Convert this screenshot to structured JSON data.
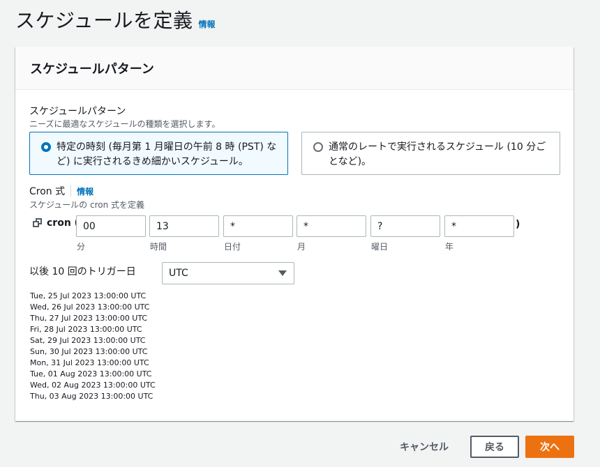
{
  "header": {
    "title": "スケジュールを定義",
    "info_link": "情報"
  },
  "panel": {
    "title": "スケジュールパターン"
  },
  "pattern": {
    "label": "スケジュールパターン",
    "description": "ニーズに最適なスケジュールの種類を選択します。",
    "options": [
      {
        "label": "特定の時刻 (毎月第 1 月曜日の午前 8 時 (PST) など) に実行されるきめ細かいスケジュール。",
        "selected": true
      },
      {
        "label": "通常のレートで実行されるスケジュール (10 分ごとなど)。",
        "selected": false
      }
    ]
  },
  "cron": {
    "label": "Cron 式",
    "info_link": "情報",
    "description": "スケジュールの cron 式を定義",
    "prefix": "cron (",
    "suffix": ")",
    "fields": [
      {
        "value": "00",
        "caption": "分"
      },
      {
        "value": "13",
        "caption": "時間"
      },
      {
        "value": "*",
        "caption": "日付"
      },
      {
        "value": "*",
        "caption": "月"
      },
      {
        "value": "?",
        "caption": "曜日"
      },
      {
        "value": "*",
        "caption": "年"
      }
    ]
  },
  "triggers": {
    "label": "以後 10 回のトリガー日",
    "timezone": "UTC",
    "dates": [
      "Tue, 25 Jul 2023 13:00:00 UTC",
      "Wed, 26 Jul 2023 13:00:00 UTC",
      "Thu, 27 Jul 2023 13:00:00 UTC",
      "Fri, 28 Jul 2023 13:00:00 UTC",
      "Sat, 29 Jul 2023 13:00:00 UTC",
      "Sun, 30 Jul 2023 13:00:00 UTC",
      "Mon, 31 Jul 2023 13:00:00 UTC",
      "Tue, 01 Aug 2023 13:00:00 UTC",
      "Wed, 02 Aug 2023 13:00:00 UTC",
      "Thu, 03 Aug 2023 13:00:00 UTC"
    ]
  },
  "footer": {
    "cancel_label": "キャンセル",
    "back_label": "戻る",
    "next_label": "次へ"
  },
  "colors": {
    "accent": "#0073bb",
    "primary_button": "#ec7211"
  }
}
